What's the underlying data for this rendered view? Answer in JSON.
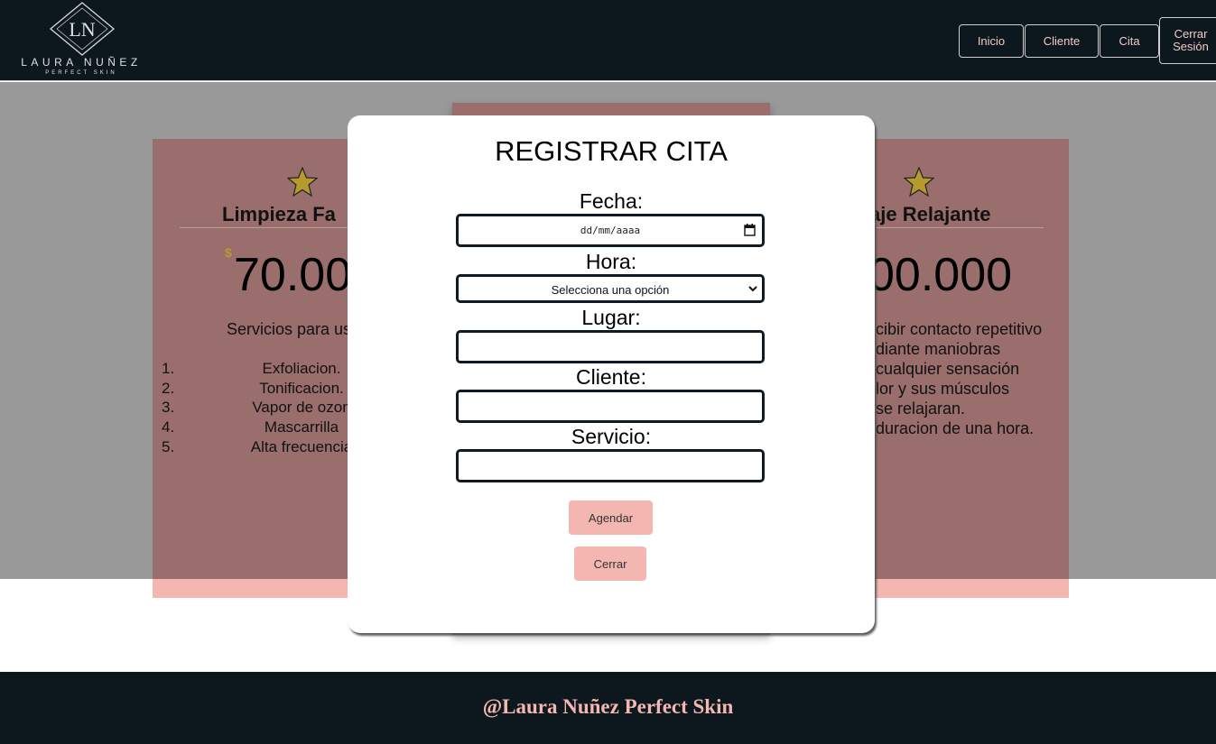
{
  "header": {
    "logo_monogram": "LN",
    "logo_name": "LAURA NUÑEZ",
    "logo_sub": "PERFECT SKIN",
    "nav": [
      {
        "label": "Inicio"
      },
      {
        "label": "Cliente"
      },
      {
        "label": "Cita"
      },
      {
        "label": "Cerrar Sesión"
      }
    ]
  },
  "cards": {
    "left": {
      "title": "Limpieza Fa",
      "currency": "$",
      "price": "70.00",
      "description": "Servicios para us",
      "list": [
        {
          "num": "1.",
          "text": "Exfoliacion."
        },
        {
          "num": "2.",
          "text": "Tonificacion."
        },
        {
          "num": "3.",
          "text": "Vapor de ozon"
        },
        {
          "num": "4.",
          "text": "Mascarrilla"
        },
        {
          "num": "5.",
          "text": "Alta frecuencia"
        }
      ]
    },
    "right": {
      "title": "aje Relajante",
      "price": "00.000",
      "lines": [
        "cibir contacto repetitivo",
        "diante maniobras",
        "cualquier sensación",
        "lor y sus músculos",
        "se relajaran.",
        "duracion de una hora."
      ]
    }
  },
  "modal": {
    "title": "REGISTRAR CITA",
    "fecha_label": "Fecha:",
    "fecha_placeholder": "dd/mm/aaaa",
    "hora_label": "Hora:",
    "hora_selected": "Selecciona una opción",
    "lugar_label": "Lugar:",
    "lugar_value": "",
    "cliente_label": "Cliente:",
    "cliente_value": "",
    "servicio_label": "Servicio:",
    "servicio_value": "",
    "agendar_label": "Agendar",
    "cerrar_label": "Cerrar"
  },
  "footer": {
    "text": "@Laura Nuñez Perfect Skin"
  },
  "colors": {
    "header_bg": "#0d171e",
    "accent_pink": "#f3b6b1",
    "card_bg": "#9a6e6c",
    "overlay_gray": "#999999",
    "star_gold": "#b59a2e"
  },
  "icons": [
    "star-icon",
    "calendar-icon",
    "chevron-down-icon"
  ]
}
